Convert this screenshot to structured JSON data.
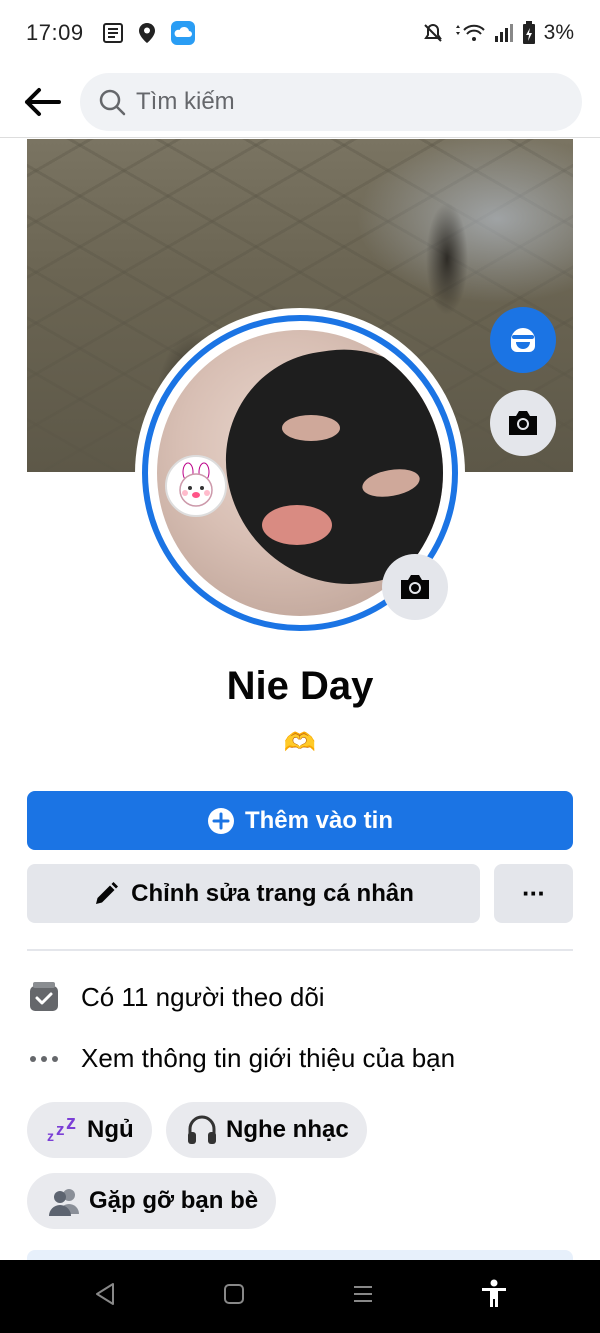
{
  "status_bar": {
    "time": "17:09",
    "battery": "3%",
    "icons": [
      "news-icon",
      "location-icon",
      "cloud-app-icon",
      "mute-icon",
      "wifi-icon",
      "signal-icon",
      "battery-icon"
    ]
  },
  "search": {
    "placeholder": "Tìm kiếm"
  },
  "profile": {
    "name": "Nie Day",
    "bio": "🫶"
  },
  "actions": {
    "add_story": "Thêm vào tin",
    "edit_profile": "Chỉnh sửa trang cá nhân",
    "more": "···"
  },
  "info": {
    "followers": "Có 11 người theo dõi",
    "about": "Xem thông tin giới thiệu của bạn"
  },
  "hobbies": [
    {
      "label": "Ngủ",
      "icon": "zzz-icon"
    },
    {
      "label": "Nghe nhạc",
      "icon": "headphones-icon"
    },
    {
      "label": "Gặp gỡ bạn bè",
      "icon": "people-icon"
    }
  ],
  "colors": {
    "accent": "#1b74e4",
    "secondary_bg": "#e4e6eb",
    "text": "#050505"
  }
}
